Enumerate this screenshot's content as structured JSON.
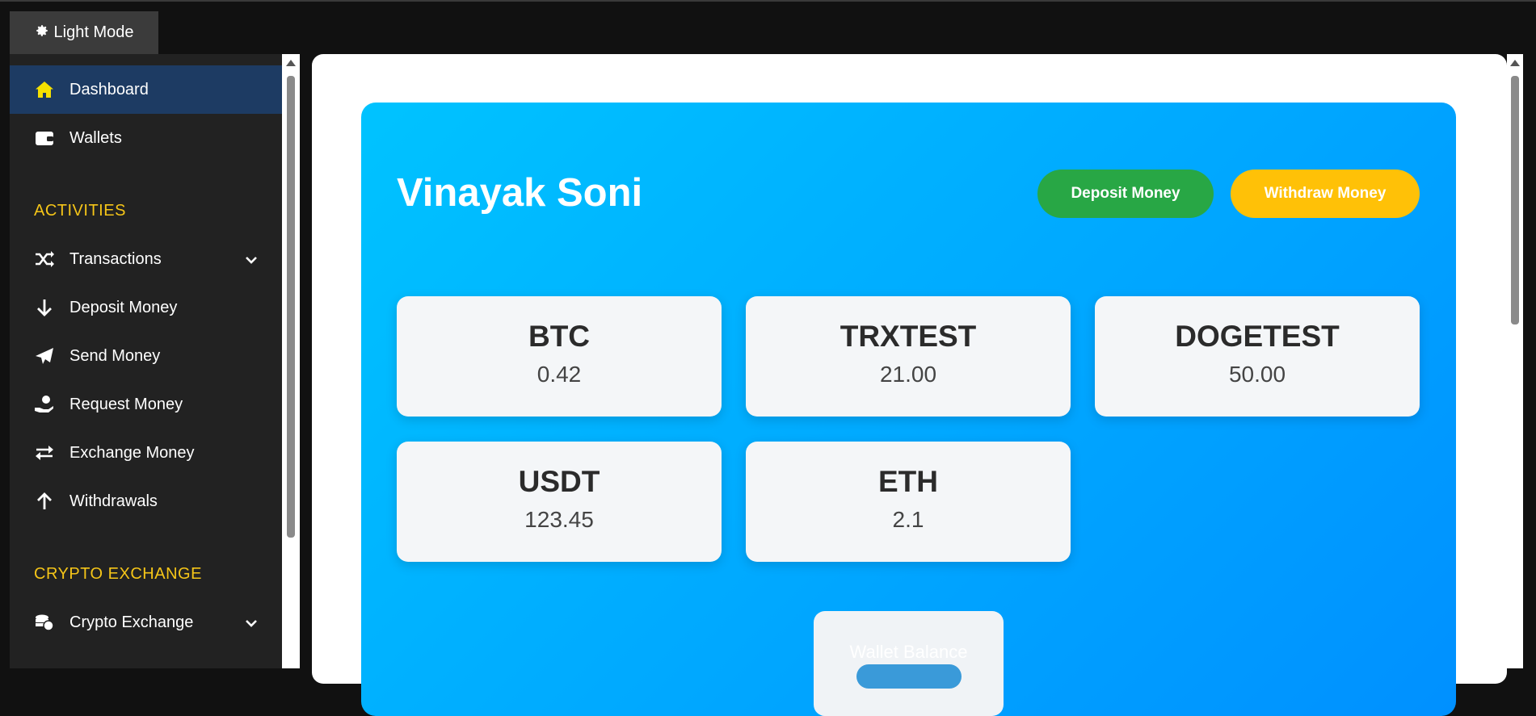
{
  "header": {
    "mode_label": "Light Mode",
    "mode_icon": "gear-icon"
  },
  "sidebar": {
    "items_top": [
      {
        "label": "Dashboard",
        "icon": "home-icon",
        "active": true
      },
      {
        "label": "Wallets",
        "icon": "wallet-icon"
      }
    ],
    "sections": [
      {
        "title": "ACTIVITIES",
        "items": [
          {
            "label": "Transactions",
            "icon": "shuffle-icon",
            "expandable": true
          },
          {
            "label": "Deposit Money",
            "icon": "arrow-down-icon"
          },
          {
            "label": "Send Money",
            "icon": "paper-plane-icon"
          },
          {
            "label": "Request Money",
            "icon": "hand-coin-icon"
          },
          {
            "label": "Exchange Money",
            "icon": "exchange-icon"
          },
          {
            "label": "Withdrawals",
            "icon": "arrow-up-icon"
          }
        ]
      },
      {
        "title": "CRYPTO EXCHANGE",
        "items": [
          {
            "label": "Crypto Exchange",
            "icon": "coins-icon",
            "expandable": true
          }
        ]
      }
    ]
  },
  "dashboard": {
    "user_name": "Vinayak Soni",
    "deposit_label": "Deposit Money",
    "withdraw_label": "Withdraw Money",
    "wallets": [
      {
        "name": "BTC",
        "value": "0.42"
      },
      {
        "name": "TRXTEST",
        "value": "21.00"
      },
      {
        "name": "DOGETEST",
        "value": "50.00"
      },
      {
        "name": "USDT",
        "value": "123.45"
      },
      {
        "name": "ETH",
        "value": "2.1"
      }
    ],
    "balance_label": "Wallet Balance"
  },
  "colors": {
    "accent_section": "#f5c518",
    "active_item": "#1d3b63",
    "deposit_btn": "#28a745",
    "withdraw_btn": "#ffc107",
    "hero_gradient_start": "#00c3ff",
    "hero_gradient_end": "#0090ff"
  }
}
